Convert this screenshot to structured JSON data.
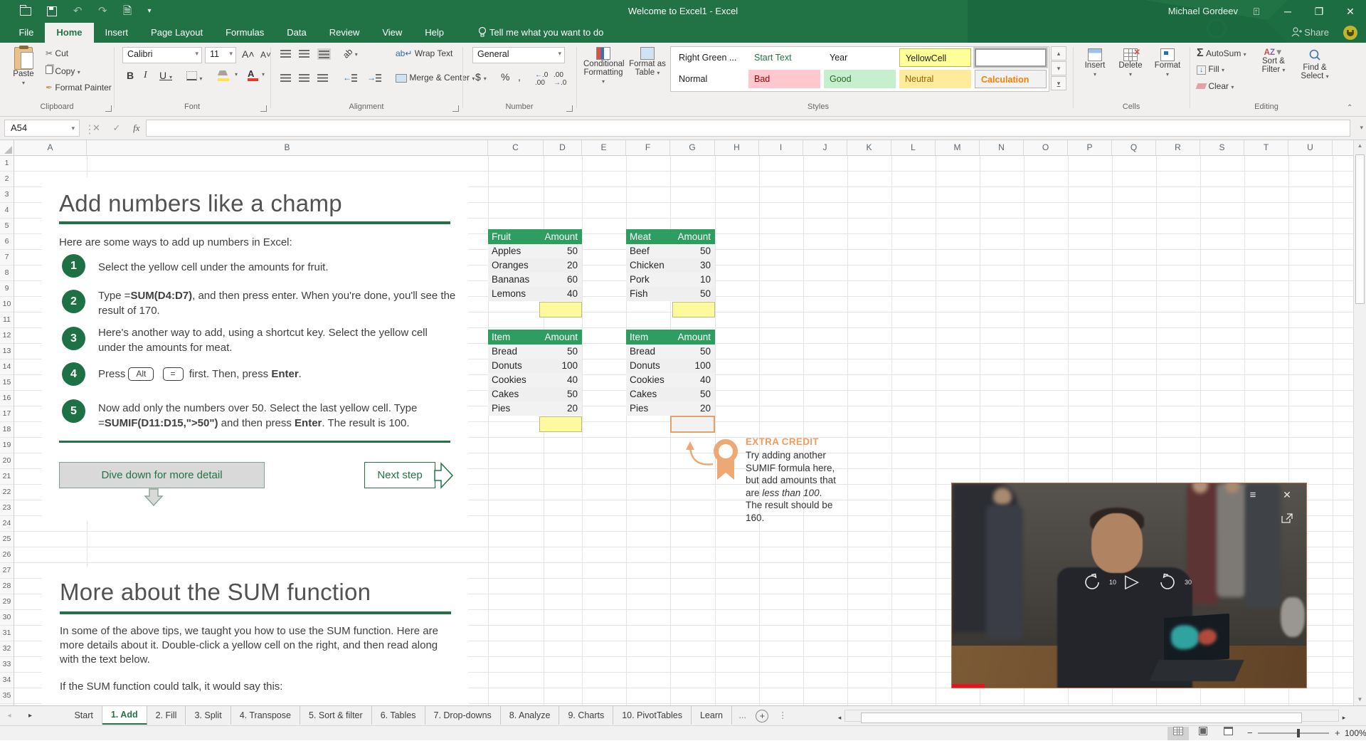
{
  "titlebar": {
    "title": "Welcome to Excel1  -  Excel",
    "user": "Michael Gordeev"
  },
  "ribbon_tabs": {
    "items": [
      {
        "label": "File",
        "class": ""
      },
      {
        "label": "Home",
        "class": "active"
      },
      {
        "label": "Insert",
        "class": ""
      },
      {
        "label": "Page Layout",
        "class": ""
      },
      {
        "label": "Formulas",
        "class": ""
      },
      {
        "label": "Data",
        "class": ""
      },
      {
        "label": "Review",
        "class": ""
      },
      {
        "label": "View",
        "class": ""
      },
      {
        "label": "Help",
        "class": ""
      }
    ],
    "tell_me": "Tell me what you want to do",
    "share": "Share"
  },
  "ribbon": {
    "clipboard": {
      "paste": "Paste",
      "cut": "Cut",
      "copy": "Copy",
      "format_painter": "Format Painter",
      "label": "Clipboard"
    },
    "font": {
      "family": "Calibri",
      "size": "11",
      "bold": "B",
      "italic": "I",
      "underline": "U",
      "label": "Font"
    },
    "alignment": {
      "wrap": "Wrap Text",
      "merge": "Merge & Center",
      "label": "Alignment"
    },
    "number": {
      "format": "General",
      "label": "Number"
    },
    "styles": {
      "cond_line1": "Conditional",
      "cond_line2": "Formatting",
      "fmt_line1": "Format as",
      "fmt_line2": "Table",
      "label": "Styles",
      "gallery": [
        {
          "label": "Right Green ...",
          "class": "st-plain"
        },
        {
          "label": "Start Text",
          "class": "st-green-text"
        },
        {
          "label": "Year",
          "class": "st-plain"
        },
        {
          "label": "YellowCell",
          "class": "st-yellow"
        },
        {
          "label": "",
          "class": "st-selected"
        },
        {
          "label": "Normal",
          "class": "st-plain"
        },
        {
          "label": "Bad",
          "class": "st-bad"
        },
        {
          "label": "Good",
          "class": "st-good"
        },
        {
          "label": "Neutral",
          "class": "st-neutral"
        },
        {
          "label": "Calculation",
          "class": "st-calc"
        }
      ]
    },
    "cells": {
      "insert": "Insert",
      "delete": "Delete",
      "format": "Format",
      "label": "Cells"
    },
    "editing": {
      "autosum": "AutoSum",
      "fill": "Fill",
      "clear": "Clear",
      "sort1": "Sort &",
      "sort2": "Filter",
      "find1": "Find &",
      "find2": "Select",
      "label": "Editing"
    }
  },
  "formula_bar": {
    "name_box": "A54",
    "fx": "fx"
  },
  "grid": {
    "col_headers": [
      "A",
      "B",
      "C",
      "D",
      "E",
      "F",
      "G",
      "H",
      "I",
      "J",
      "K",
      "L",
      "M",
      "N",
      "O",
      "P",
      "Q",
      "R",
      "S",
      "T",
      "U"
    ],
    "row_numbers": [
      1,
      2,
      3,
      4,
      5,
      6,
      7,
      8,
      9,
      10,
      11,
      12,
      13,
      14,
      15,
      16,
      17,
      18,
      19,
      20,
      21,
      22,
      23,
      24,
      25,
      26,
      27,
      28,
      29,
      30,
      31,
      32,
      33,
      34,
      35
    ]
  },
  "section1": {
    "title": "Add numbers like a champ",
    "intro": "Here are some ways to add up numbers in Excel:",
    "steps": [
      {
        "num": "1",
        "text": [
          {
            "t": "Select the yellow cell under the amounts for fruit."
          }
        ]
      },
      {
        "num": "2",
        "text": [
          {
            "t": "Type ="
          },
          {
            "t": "SUM(D4:D7)",
            "s": "b"
          },
          {
            "t": ", and then press enter. When you're done, you'll see the result of 170."
          }
        ]
      },
      {
        "num": "3",
        "text": [
          {
            "t": "Here's another way to add, using a shortcut key. Select the yellow cell under the amounts for meat."
          }
        ]
      },
      {
        "num": "4",
        "text": [
          {
            "t": "Press"
          },
          {
            "t": "Alt",
            "s": "key"
          },
          {
            "t": " "
          },
          {
            "t": "=",
            "s": "key"
          },
          {
            "t": " first. Then, press "
          },
          {
            "t": "Enter",
            "s": "b"
          },
          {
            "t": "."
          }
        ]
      },
      {
        "num": "5",
        "text": [
          {
            "t": "Now add only the numbers over 50. Select the last yellow cell. Type ="
          },
          {
            "t": "SUMIF(D11:D15,\">50\")",
            "s": "b"
          },
          {
            "t": " and then press "
          },
          {
            "t": "Enter",
            "s": "b"
          },
          {
            "t": ". The result is 100."
          }
        ]
      }
    ],
    "dive_button": "Dive down for more detail",
    "next_button": "Next step"
  },
  "tables": {
    "fruit": {
      "headers": [
        "Fruit",
        "Amount"
      ],
      "rows": [
        [
          "Apples",
          "50"
        ],
        [
          "Oranges",
          "20"
        ],
        [
          "Bananas",
          "60"
        ],
        [
          "Lemons",
          "40"
        ]
      ]
    },
    "meat": {
      "headers": [
        "Meat",
        "Amount"
      ],
      "rows": [
        [
          "Beef",
          "50"
        ],
        [
          "Chicken",
          "30"
        ],
        [
          "Pork",
          "10"
        ],
        [
          "Fish",
          "50"
        ]
      ]
    },
    "item1": {
      "headers": [
        "Item",
        "Amount"
      ],
      "rows": [
        [
          "Bread",
          "50"
        ],
        [
          "Donuts",
          "100"
        ],
        [
          "Cookies",
          "40"
        ],
        [
          "Cakes",
          "50"
        ],
        [
          "Pies",
          "20"
        ]
      ]
    },
    "item2": {
      "headers": [
        "Item",
        "Amount"
      ],
      "rows": [
        [
          "Bread",
          "50"
        ],
        [
          "Donuts",
          "100"
        ],
        [
          "Cookies",
          "40"
        ],
        [
          "Cakes",
          "50"
        ],
        [
          "Pies",
          "20"
        ]
      ]
    }
  },
  "extra_credit": {
    "heading": "EXTRA CREDIT",
    "text": [
      {
        "t": "Try adding another SUMIF formula here, but add amounts that are "
      },
      {
        "t": "less than 100",
        "s": "i"
      },
      {
        "t": ". The result should be 160."
      }
    ]
  },
  "section2": {
    "title": "More about the SUM function",
    "p1": "In some of the above tips, we taught you how to use the SUM function. Here are more details about it. Double-click a yellow cell on the right, and then read along with the text below.",
    "p2": "If the SUM function could talk, it would say this:"
  },
  "video": {
    "rewind_label": "10",
    "forward_label": "30"
  },
  "sheet_tabs": {
    "tabs": [
      {
        "label": "Start",
        "class": ""
      },
      {
        "label": "1. Add",
        "class": "active"
      },
      {
        "label": "2. Fill",
        "class": ""
      },
      {
        "label": "3. Split",
        "class": ""
      },
      {
        "label": "4. Transpose",
        "class": ""
      },
      {
        "label": "5. Sort & filter",
        "class": ""
      },
      {
        "label": "6. Tables",
        "class": ""
      },
      {
        "label": "7. Drop-downs",
        "class": ""
      },
      {
        "label": "8. Analyze",
        "class": ""
      },
      {
        "label": "9. Charts",
        "class": ""
      },
      {
        "label": "10. PivotTables",
        "class": ""
      },
      {
        "label": "Learn",
        "class": ""
      }
    ],
    "overflow": "..."
  },
  "status_bar": {
    "zoom": "100%"
  },
  "colors": {
    "excel_green": "#217346",
    "table_header_green": "#2e9e60",
    "yellow_cell": "#fdfa9e",
    "accent_orange": "#ed9c5c",
    "bad_bg": "#ffc7ce",
    "bad_fg": "#9c0006",
    "good_bg": "#c6efce",
    "good_fg": "#276b24",
    "neutral_bg": "#ffeb9c",
    "neutral_fg": "#9c6500",
    "calculation_fg": "#fa7d00",
    "video_progress_red": "#e81123"
  }
}
